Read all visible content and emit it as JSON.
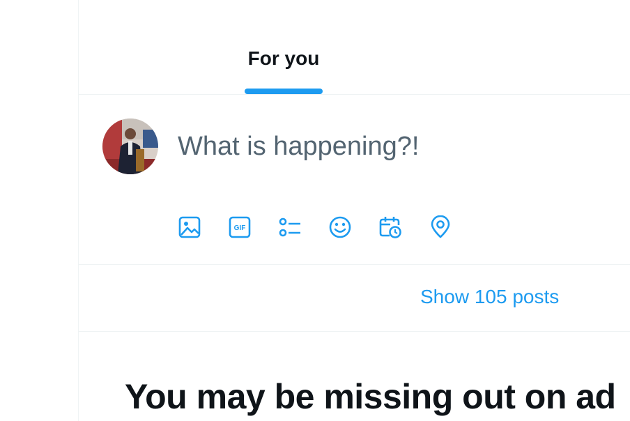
{
  "tabs": [
    {
      "label": "For you",
      "selected": true
    }
  ],
  "composer": {
    "placeholder": "What is happening?!",
    "tools": [
      "image-icon",
      "gif-icon",
      "poll-icon",
      "emoji-icon",
      "schedule-icon",
      "location-icon"
    ]
  },
  "timeline": {
    "show_posts_label": "Show 105 posts"
  },
  "promo": {
    "headline": "You may be missing out on ad"
  },
  "colors": {
    "accent": "#1d9bf0",
    "text_primary": "#0f1419",
    "text_secondary": "#536471",
    "border": "#eff3f4"
  }
}
